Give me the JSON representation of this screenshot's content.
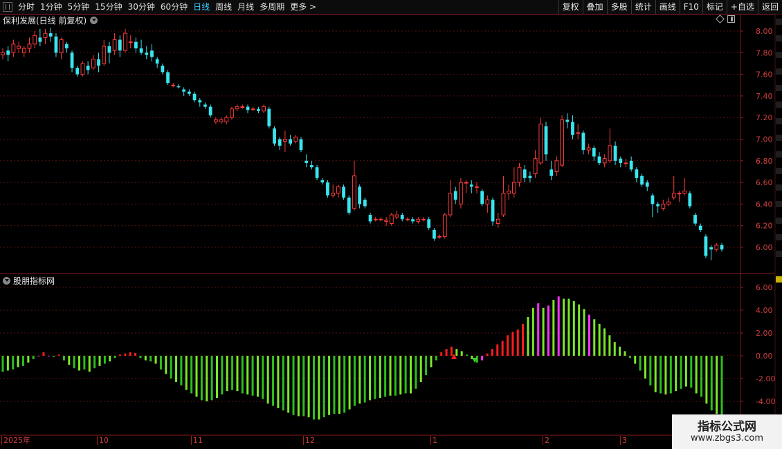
{
  "toolbar": {
    "periods": [
      "分时",
      "1分钟",
      "5分钟",
      "15分钟",
      "30分钟",
      "60分钟",
      "日线",
      "周线",
      "月线",
      "多周期",
      "更多"
    ],
    "active_period": "日线",
    "more_arrow": ">",
    "buttons": [
      "复权",
      "叠加",
      "多股",
      "统计",
      "画线",
      "F10",
      "标记",
      "+自选",
      "返回"
    ]
  },
  "main_chart": {
    "title": "保利发展(日线 前复权)",
    "y_ticks": [
      "8.00",
      "7.80",
      "7.60",
      "7.40",
      "7.20",
      "7.00",
      "6.80",
      "6.60",
      "6.40",
      "6.20",
      "6.00"
    ]
  },
  "indicator": {
    "title": "股朋指标网",
    "y_ticks": [
      "6.00",
      "4.00",
      "2.00",
      "0.00",
      "-2.00",
      "-4.00"
    ]
  },
  "x_axis": {
    "labels": [
      "2025年",
      "10",
      "11",
      "12",
      "1",
      "2",
      "3"
    ]
  },
  "watermark": {
    "line1": "指标公式网",
    "line2": "www.zbgs3.com"
  },
  "colors": {
    "up": "#ff3c3c",
    "down": "#39e5ee",
    "bar_green": "#2dbf1d",
    "bar_lime": "#7ae82a",
    "bar_red": "#ff1e1e",
    "bar_magenta": "#ff33ff",
    "grid": "#5a1212",
    "axis_text": "#cf4040"
  },
  "chart_data": [
    {
      "type": "candlestick",
      "title": "保利发展(日线 前复权)",
      "ylim": [
        5.9,
        8.05
      ],
      "series": [
        {
          "o": 7.78,
          "c": 7.8,
          "h": 7.84,
          "l": 7.74
        },
        {
          "o": 7.82,
          "c": 7.78,
          "h": 7.86,
          "l": 7.72
        },
        {
          "o": 7.8,
          "c": 7.88,
          "h": 7.92,
          "l": 7.76
        },
        {
          "o": 7.84,
          "c": 7.86,
          "h": 7.9,
          "l": 7.8
        },
        {
          "o": 7.8,
          "c": 7.84,
          "h": 7.86,
          "l": 7.76
        },
        {
          "o": 7.84,
          "c": 7.88,
          "h": 7.94,
          "l": 7.8
        },
        {
          "o": 7.88,
          "c": 7.96,
          "h": 8.0,
          "l": 7.84
        },
        {
          "o": 7.94,
          "c": 7.9,
          "h": 8.02,
          "l": 7.86
        },
        {
          "o": 7.94,
          "c": 7.98,
          "h": 8.02,
          "l": 7.88
        },
        {
          "o": 7.98,
          "c": 7.95,
          "h": 8.03,
          "l": 7.9
        },
        {
          "o": 7.95,
          "c": 7.8,
          "h": 7.98,
          "l": 7.76
        },
        {
          "o": 7.8,
          "c": 7.92,
          "h": 7.94,
          "l": 7.74
        },
        {
          "o": 7.88,
          "c": 7.84,
          "h": 7.9,
          "l": 7.8
        },
        {
          "o": 7.8,
          "c": 7.66,
          "h": 7.82,
          "l": 7.62
        },
        {
          "o": 7.66,
          "c": 7.6,
          "h": 7.68,
          "l": 7.58
        },
        {
          "o": 7.6,
          "c": 7.7,
          "h": 7.72,
          "l": 7.58
        },
        {
          "o": 7.68,
          "c": 7.64,
          "h": 7.72,
          "l": 7.6
        },
        {
          "o": 7.66,
          "c": 7.74,
          "h": 7.78,
          "l": 7.64
        },
        {
          "o": 7.74,
          "c": 7.68,
          "h": 7.8,
          "l": 7.62
        },
        {
          "o": 7.7,
          "c": 7.86,
          "h": 7.92,
          "l": 7.68
        },
        {
          "o": 7.86,
          "c": 7.8,
          "h": 7.9,
          "l": 7.7
        },
        {
          "o": 7.82,
          "c": 7.92,
          "h": 7.98,
          "l": 7.78
        },
        {
          "o": 7.92,
          "c": 7.82,
          "h": 7.96,
          "l": 7.76
        },
        {
          "o": 7.82,
          "c": 7.98,
          "h": 8.02,
          "l": 7.8
        },
        {
          "o": 7.9,
          "c": 7.9,
          "h": 7.96,
          "l": 7.84
        },
        {
          "o": 7.9,
          "c": 7.84,
          "h": 7.94,
          "l": 7.8
        },
        {
          "o": 7.84,
          "c": 7.8,
          "h": 7.92,
          "l": 7.78
        },
        {
          "o": 7.8,
          "c": 7.78,
          "h": 7.86,
          "l": 7.74
        },
        {
          "o": 7.82,
          "c": 7.76,
          "h": 7.88,
          "l": 7.72
        },
        {
          "o": 7.74,
          "c": 7.7,
          "h": 7.76,
          "l": 7.66
        },
        {
          "o": 7.68,
          "c": 7.62,
          "h": 7.7,
          "l": 7.6
        },
        {
          "o": 7.62,
          "c": 7.52,
          "h": 7.64,
          "l": 7.5
        },
        {
          "o": 7.5,
          "c": 7.5,
          "h": 7.52,
          "l": 7.48
        },
        {
          "o": 7.49,
          "c": 7.48,
          "h": 7.51,
          "l": 7.47
        },
        {
          "o": 7.46,
          "c": 7.44,
          "h": 7.48,
          "l": 7.4
        },
        {
          "o": 7.44,
          "c": 7.42,
          "h": 7.46,
          "l": 7.4
        },
        {
          "o": 7.42,
          "c": 7.36,
          "h": 7.44,
          "l": 7.34
        },
        {
          "o": 7.36,
          "c": 7.34,
          "h": 7.38,
          "l": 7.3
        },
        {
          "o": 7.32,
          "c": 7.3,
          "h": 7.34,
          "l": 7.28
        },
        {
          "o": 7.3,
          "c": 7.22,
          "h": 7.32,
          "l": 7.2
        },
        {
          "o": 7.16,
          "c": 7.18,
          "h": 7.2,
          "l": 7.14
        },
        {
          "o": 7.16,
          "c": 7.18,
          "h": 7.2,
          "l": 7.14
        },
        {
          "o": 7.16,
          "c": 7.2,
          "h": 7.22,
          "l": 7.14
        },
        {
          "o": 7.2,
          "c": 7.28,
          "h": 7.3,
          "l": 7.18
        },
        {
          "o": 7.28,
          "c": 7.3,
          "h": 7.32,
          "l": 7.26
        },
        {
          "o": 7.3,
          "c": 7.3,
          "h": 7.32,
          "l": 7.28
        },
        {
          "o": 7.3,
          "c": 7.27,
          "h": 7.32,
          "l": 7.24
        },
        {
          "o": 7.28,
          "c": 7.28,
          "h": 7.3,
          "l": 7.26
        },
        {
          "o": 7.28,
          "c": 7.26,
          "h": 7.3,
          "l": 7.24
        },
        {
          "o": 7.26,
          "c": 7.3,
          "h": 7.32,
          "l": 7.24
        },
        {
          "o": 7.28,
          "c": 7.12,
          "h": 7.3,
          "l": 7.1
        },
        {
          "o": 7.1,
          "c": 6.96,
          "h": 7.12,
          "l": 6.94
        },
        {
          "o": 7.0,
          "c": 6.94,
          "h": 7.02,
          "l": 6.9
        },
        {
          "o": 6.98,
          "c": 7.0,
          "h": 7.08,
          "l": 6.88
        },
        {
          "o": 7.0,
          "c": 6.96,
          "h": 7.04,
          "l": 6.94
        },
        {
          "o": 6.98,
          "c": 7.02,
          "h": 7.04,
          "l": 6.96
        },
        {
          "o": 7.0,
          "c": 6.9,
          "h": 7.02,
          "l": 6.88
        },
        {
          "o": 6.8,
          "c": 6.78,
          "h": 6.86,
          "l": 6.74
        },
        {
          "o": 6.76,
          "c": 6.74,
          "h": 6.8,
          "l": 6.72
        },
        {
          "o": 6.74,
          "c": 6.64,
          "h": 6.76,
          "l": 6.62
        },
        {
          "o": 6.62,
          "c": 6.6,
          "h": 6.64,
          "l": 6.58
        },
        {
          "o": 6.6,
          "c": 6.48,
          "h": 6.62,
          "l": 6.46
        },
        {
          "o": 6.48,
          "c": 6.5,
          "h": 6.58,
          "l": 6.46
        },
        {
          "o": 6.5,
          "c": 6.56,
          "h": 6.58,
          "l": 6.46
        },
        {
          "o": 6.56,
          "c": 6.46,
          "h": 6.58,
          "l": 6.44
        },
        {
          "o": 6.46,
          "c": 6.32,
          "h": 6.48,
          "l": 6.3
        },
        {
          "o": 6.36,
          "c": 6.66,
          "h": 6.8,
          "l": 6.34
        },
        {
          "o": 6.56,
          "c": 6.4,
          "h": 6.58,
          "l": 6.36
        },
        {
          "o": 6.44,
          "c": 6.38,
          "h": 6.46,
          "l": 6.36
        },
        {
          "o": 6.3,
          "c": 6.24,
          "h": 6.32,
          "l": 6.22
        },
        {
          "o": 6.26,
          "c": 6.26,
          "h": 6.28,
          "l": 6.24
        },
        {
          "o": 6.26,
          "c": 6.26,
          "h": 6.28,
          "l": 6.24
        },
        {
          "o": 6.24,
          "c": 6.25,
          "h": 6.28,
          "l": 6.2
        },
        {
          "o": 6.22,
          "c": 6.3,
          "h": 6.32,
          "l": 6.2
        },
        {
          "o": 6.28,
          "c": 6.3,
          "h": 6.34,
          "l": 6.26
        },
        {
          "o": 6.3,
          "c": 6.26,
          "h": 6.32,
          "l": 6.24
        },
        {
          "o": 6.26,
          "c": 6.26,
          "h": 6.28,
          "l": 6.24
        },
        {
          "o": 6.26,
          "c": 6.24,
          "h": 6.28,
          "l": 6.22
        },
        {
          "o": 6.24,
          "c": 6.26,
          "h": 6.28,
          "l": 6.22
        },
        {
          "o": 6.26,
          "c": 6.26,
          "h": 6.28,
          "l": 6.24
        },
        {
          "o": 6.26,
          "c": 6.18,
          "h": 6.28,
          "l": 6.16
        },
        {
          "o": 6.16,
          "c": 6.08,
          "h": 6.18,
          "l": 6.06
        },
        {
          "o": 6.1,
          "c": 6.1,
          "h": 6.12,
          "l": 6.08
        },
        {
          "o": 6.1,
          "c": 6.3,
          "h": 6.32,
          "l": 6.08
        },
        {
          "o": 6.3,
          "c": 6.5,
          "h": 6.62,
          "l": 6.28
        },
        {
          "o": 6.52,
          "c": 6.44,
          "h": 6.56,
          "l": 6.4
        },
        {
          "o": 6.4,
          "c": 6.6,
          "h": 6.64,
          "l": 6.36
        },
        {
          "o": 6.6,
          "c": 6.6,
          "h": 6.62,
          "l": 6.5
        },
        {
          "o": 6.58,
          "c": 6.56,
          "h": 6.62,
          "l": 6.5
        },
        {
          "o": 6.56,
          "c": 6.56,
          "h": 6.6,
          "l": 6.5
        },
        {
          "o": 6.52,
          "c": 6.4,
          "h": 6.54,
          "l": 6.38
        },
        {
          "o": 6.4,
          "c": 6.44,
          "h": 6.48,
          "l": 6.32
        },
        {
          "o": 6.44,
          "c": 6.24,
          "h": 6.46,
          "l": 6.2
        },
        {
          "o": 6.22,
          "c": 6.26,
          "h": 6.32,
          "l": 6.18
        },
        {
          "o": 6.3,
          "c": 6.5,
          "h": 6.66,
          "l": 6.28
        },
        {
          "o": 6.5,
          "c": 6.52,
          "h": 6.58,
          "l": 6.44
        },
        {
          "o": 6.5,
          "c": 6.6,
          "h": 6.74,
          "l": 6.46
        },
        {
          "o": 6.6,
          "c": 6.74,
          "h": 6.78,
          "l": 6.56
        },
        {
          "o": 6.72,
          "c": 6.64,
          "h": 6.76,
          "l": 6.6
        },
        {
          "o": 6.66,
          "c": 6.64,
          "h": 6.7,
          "l": 6.6
        },
        {
          "o": 6.68,
          "c": 6.82,
          "h": 6.9,
          "l": 6.64
        },
        {
          "o": 6.78,
          "c": 7.14,
          "h": 7.2,
          "l": 6.76
        },
        {
          "o": 7.12,
          "c": 6.86,
          "h": 7.16,
          "l": 6.8
        },
        {
          "o": 6.72,
          "c": 6.66,
          "h": 6.8,
          "l": 6.62
        },
        {
          "o": 6.7,
          "c": 6.8,
          "h": 6.84,
          "l": 6.66
        },
        {
          "o": 6.76,
          "c": 7.18,
          "h": 7.22,
          "l": 6.74
        },
        {
          "o": 7.18,
          "c": 7.16,
          "h": 7.24,
          "l": 7.1
        },
        {
          "o": 7.16,
          "c": 7.04,
          "h": 7.22,
          "l": 7.0
        },
        {
          "o": 7.06,
          "c": 7.06,
          "h": 7.14,
          "l": 7.0
        },
        {
          "o": 7.06,
          "c": 6.9,
          "h": 7.08,
          "l": 6.86
        },
        {
          "o": 6.9,
          "c": 6.92,
          "h": 6.96,
          "l": 6.86
        },
        {
          "o": 6.92,
          "c": 6.84,
          "h": 6.94,
          "l": 6.8
        },
        {
          "o": 6.84,
          "c": 6.78,
          "h": 6.88,
          "l": 6.76
        },
        {
          "o": 6.78,
          "c": 6.82,
          "h": 6.86,
          "l": 6.74
        },
        {
          "o": 6.8,
          "c": 6.94,
          "h": 7.1,
          "l": 6.78
        },
        {
          "o": 6.94,
          "c": 6.8,
          "h": 6.98,
          "l": 6.76
        },
        {
          "o": 6.82,
          "c": 6.78,
          "h": 6.84,
          "l": 6.74
        },
        {
          "o": 6.78,
          "c": 6.78,
          "h": 6.82,
          "l": 6.74
        },
        {
          "o": 6.8,
          "c": 6.72,
          "h": 6.84,
          "l": 6.7
        },
        {
          "o": 6.72,
          "c": 6.64,
          "h": 6.74,
          "l": 6.6
        },
        {
          "o": 6.66,
          "c": 6.58,
          "h": 6.68,
          "l": 6.56
        },
        {
          "o": 6.6,
          "c": 6.56,
          "h": 6.62,
          "l": 6.52
        },
        {
          "o": 6.48,
          "c": 6.4,
          "h": 6.5,
          "l": 6.28
        },
        {
          "o": 6.4,
          "c": 6.38,
          "h": 6.42,
          "l": 6.32
        },
        {
          "o": 6.36,
          "c": 6.4,
          "h": 6.44,
          "l": 6.34
        },
        {
          "o": 6.4,
          "c": 6.42,
          "h": 6.46,
          "l": 6.38
        },
        {
          "o": 6.46,
          "c": 6.5,
          "h": 6.66,
          "l": 6.44
        },
        {
          "o": 6.5,
          "c": 6.5,
          "h": 6.52,
          "l": 6.42
        },
        {
          "o": 6.5,
          "c": 6.52,
          "h": 6.64,
          "l": 6.48
        },
        {
          "o": 6.5,
          "c": 6.38,
          "h": 6.52,
          "l": 6.36
        },
        {
          "o": 6.3,
          "c": 6.22,
          "h": 6.32,
          "l": 6.2
        },
        {
          "o": 6.2,
          "c": 6.16,
          "h": 6.22,
          "l": 6.14
        },
        {
          "o": 6.1,
          "c": 5.92,
          "h": 6.12,
          "l": 5.9
        },
        {
          "o": 6.0,
          "c": 5.98,
          "h": 6.02,
          "l": 5.88
        },
        {
          "o": 5.98,
          "c": 6.02,
          "h": 6.04,
          "l": 5.96
        },
        {
          "o": 6.02,
          "c": 5.98,
          "h": 6.04,
          "l": 5.96
        }
      ]
    },
    {
      "type": "bar",
      "title": "股朋指标网",
      "ylim": [
        -6.0,
        6.3
      ],
      "values": [
        -1.4,
        -1.3,
        -1.2,
        -1.0,
        -0.9,
        -0.6,
        -0.3,
        0.0,
        0.3,
        -0.05,
        -0.1,
        0.1,
        -0.4,
        -0.8,
        -1.1,
        -1.3,
        -1.2,
        -1.4,
        -1.1,
        -0.9,
        -0.7,
        -0.5,
        -0.2,
        0.1,
        0.2,
        0.3,
        0.25,
        -0.2,
        -0.4,
        -0.5,
        -0.7,
        -1.2,
        -1.6,
        -2.0,
        -2.3,
        -2.6,
        -3.0,
        -3.3,
        -3.6,
        -3.9,
        -4.0,
        -3.9,
        -3.7,
        -3.4,
        -3.1,
        -3.0,
        -3.1,
        -3.3,
        -3.4,
        -3.5,
        -3.6,
        -3.8,
        -4.2,
        -4.4,
        -4.6,
        -4.8,
        -5.0,
        -5.2,
        -5.3,
        -5.3,
        -5.4,
        -5.6,
        -5.6,
        -5.4,
        -5.2,
        -5.1,
        -5.1,
        -5.0,
        -4.7,
        -4.4,
        -4.2,
        -4.1,
        -3.9,
        -3.8,
        -3.7,
        -3.6,
        -3.5,
        -3.5,
        -3.4,
        -3.3,
        -3.3,
        -2.9,
        -2.3,
        -1.7,
        -1.0,
        -0.4,
        0.3,
        0.6,
        0.8,
        0.6,
        0.4,
        0.1,
        -0.3,
        -0.6,
        -0.4,
        0.2,
        0.6,
        1.0,
        1.3,
        1.8,
        2.1,
        2.3,
        2.8,
        3.4,
        4.2,
        4.6,
        4.2,
        4.4,
        4.9,
        5.2,
        5.0,
        5.0,
        4.8,
        4.5,
        4.1,
        3.6,
        3.2,
        2.8,
        2.4,
        1.8,
        1.2,
        0.8,
        0.4,
        -0.2,
        -0.7,
        -1.3,
        -2.0,
        -2.6,
        -3.2,
        -3.3,
        -3.4,
        -3.3,
        -3.1,
        -2.9,
        -2.7,
        -2.8,
        -3.3,
        -3.6,
        -4.2,
        -4.8,
        -5.1,
        -5.4
      ],
      "colors": [
        "g",
        "l",
        "g",
        "l",
        "g",
        "l",
        "g",
        "m",
        "r",
        "m",
        "g",
        "r",
        "g",
        "l",
        "g",
        "l",
        "g",
        "l",
        "g",
        "l",
        "g",
        "l",
        "g",
        "r",
        "r",
        "r",
        "r",
        "g",
        "l",
        "g",
        "l",
        "g",
        "l",
        "g",
        "l",
        "g",
        "l",
        "g",
        "l",
        "g",
        "l",
        "g",
        "l",
        "g",
        "l",
        "g",
        "l",
        "g",
        "l",
        "g",
        "l",
        "g",
        "l",
        "g",
        "l",
        "g",
        "l",
        "g",
        "l",
        "g",
        "l",
        "g",
        "l",
        "g",
        "l",
        "g",
        "l",
        "g",
        "l",
        "g",
        "l",
        "g",
        "l",
        "g",
        "l",
        "g",
        "l",
        "g",
        "l",
        "g",
        "l",
        "g",
        "l",
        "g",
        "l",
        "g",
        "r",
        "r",
        "r",
        "l",
        "l",
        "g",
        "l",
        "g",
        "m",
        "r",
        "r",
        "r",
        "r",
        "r",
        "r",
        "r",
        "r",
        "l",
        "l",
        "m",
        "l",
        "m",
        "l",
        "m",
        "l",
        "l",
        "l",
        "l",
        "l",
        "m",
        "l",
        "l",
        "l",
        "l",
        "l",
        "l",
        "l",
        "g",
        "l",
        "g",
        "l",
        "g",
        "l",
        "g",
        "l",
        "g",
        "l",
        "g",
        "l",
        "g",
        "l",
        "g",
        "l",
        "g",
        "l",
        "g"
      ]
    }
  ]
}
